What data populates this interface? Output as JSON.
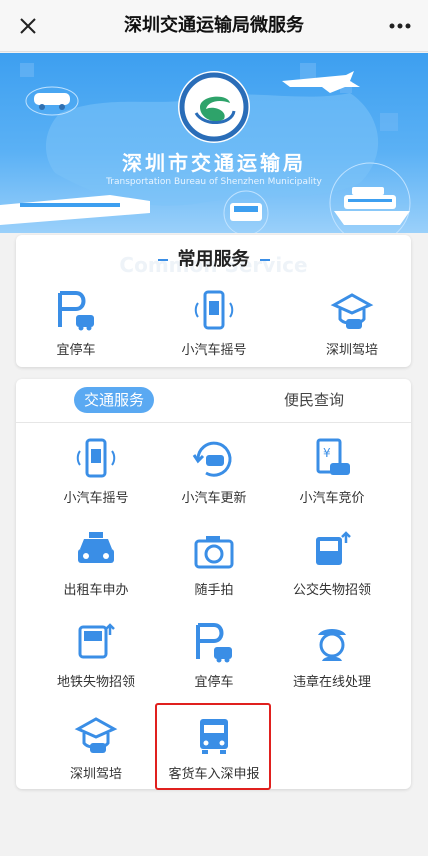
{
  "header": {
    "title": "深圳交通运输局微服务"
  },
  "banner": {
    "org_name": "深圳市交通运输局",
    "org_name_en": "Transportation Bureau of Shenzhen Municipality",
    "logo_text": "深圳市交通运输局"
  },
  "common_services": {
    "title": "常用服务",
    "ghost_title": "Common Service",
    "items": [
      {
        "label": "宜停车",
        "icon": "parking-icon"
      },
      {
        "label": "小汽车摇号",
        "icon": "phone-lottery-icon"
      },
      {
        "label": "深圳驾培",
        "icon": "driving-school-icon"
      }
    ]
  },
  "services_panel": {
    "tabs": [
      {
        "label": "交通服务",
        "active": true
      },
      {
        "label": "便民查询",
        "active": false
      }
    ],
    "items": [
      {
        "label": "小汽车摇号",
        "icon": "phone-lottery-icon"
      },
      {
        "label": "小汽车更新",
        "icon": "car-renew-icon"
      },
      {
        "label": "小汽车竞价",
        "icon": "car-bid-icon"
      },
      {
        "label": "出租车申办",
        "icon": "taxi-icon"
      },
      {
        "label": "随手拍",
        "icon": "camera-icon"
      },
      {
        "label": "公交失物招领",
        "icon": "bus-lost-found-icon"
      },
      {
        "label": "地铁失物招领",
        "icon": "metro-lost-found-icon"
      },
      {
        "label": "宜停车",
        "icon": "parking-icon"
      },
      {
        "label": "违章在线处理",
        "icon": "police-icon"
      },
      {
        "label": "深圳驾培",
        "icon": "driving-school-icon"
      },
      {
        "label": "客货车入深申报",
        "icon": "truck-icon"
      }
    ]
  },
  "colors": {
    "accent": "#3a8ee6",
    "tab_active": "#5aa9f2",
    "highlight": "#e0201e"
  }
}
